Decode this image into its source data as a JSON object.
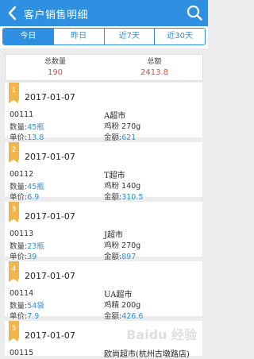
{
  "header": {
    "title": "客户销售明细",
    "back_icon": "chevron-left-icon",
    "search_icon": "search-icon"
  },
  "tabs": [
    {
      "label": "今日",
      "active": true
    },
    {
      "label": "昨日",
      "active": false
    },
    {
      "label": "近7天",
      "active": false
    },
    {
      "label": "近30天",
      "active": false
    }
  ],
  "summary": {
    "qty_label": "总数量",
    "qty_value": "190",
    "amount_label": "总额",
    "amount_value": "2413.8",
    "value_color": "#e74c3c"
  },
  "colors": {
    "accent": "#2f8fe0",
    "badge": "#f1b54a"
  },
  "orders": [
    {
      "index": "1",
      "date": "2017-01-07",
      "code": "00111",
      "qty_label": "数量:",
      "qty": "45瓶",
      "price_label": "单价:",
      "price": "13.8",
      "store": "A超市",
      "product": "鸡粉 270g",
      "amount_label": "金额:",
      "amount": "621"
    },
    {
      "index": "2",
      "date": "2017-01-07",
      "code": "00112",
      "qty_label": "数量:",
      "qty": "45瓶",
      "price_label": "单价:",
      "price": "6.9",
      "store": "T超市",
      "product": "鸡粉 140g",
      "amount_label": "金额:",
      "amount": "310.5"
    },
    {
      "index": "3",
      "date": "2017-01-07",
      "code": "00113",
      "qty_label": "数量:",
      "qty": "23瓶",
      "price_label": "单价:",
      "price": "39",
      "store": "J超市",
      "product": "鸡粉 270g",
      "amount_label": "金额:",
      "amount": "897"
    },
    {
      "index": "4",
      "date": "2017-01-07",
      "code": "00114",
      "qty_label": "数量:",
      "qty": "54袋",
      "price_label": "单价:",
      "price": "7.9",
      "store": "UA超市",
      "product": "鸡精 200g",
      "amount_label": "金额:",
      "amount": "426.6"
    },
    {
      "index": "5",
      "date": "2017-01-07",
      "code": "00115",
      "qty_label": "",
      "qty": "",
      "price_label": "",
      "price": "",
      "store": "欧尚超市(杭州古墩路店)",
      "product": "",
      "amount_label": "",
      "amount": ""
    }
  ],
  "watermark": "Baidu 经验"
}
